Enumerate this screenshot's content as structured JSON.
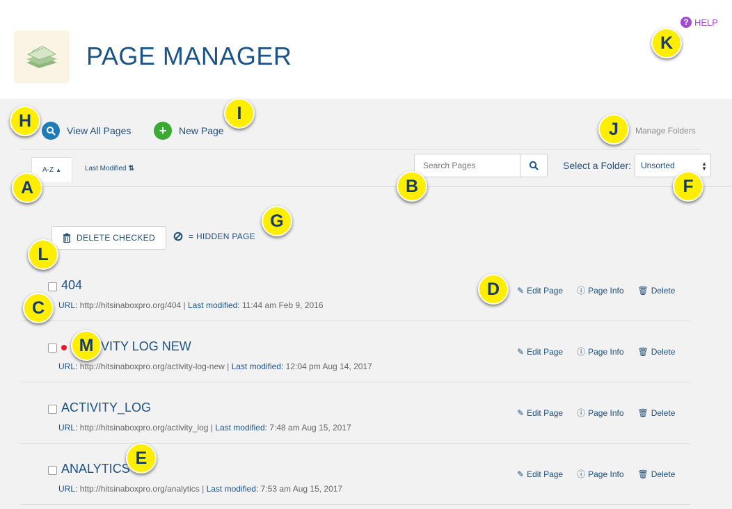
{
  "header": {
    "title": "PAGE MANAGER",
    "help_label": "HELP"
  },
  "nav": {
    "view_all": "View All Pages",
    "new_page": "New Page",
    "manage_folders": "Manage Folders"
  },
  "sort": {
    "az": "A-Z",
    "last_modified": "Last Modified"
  },
  "search": {
    "placeholder": "Search Pages"
  },
  "folder": {
    "label": "Select a Folder:",
    "selected": "Unsorted"
  },
  "toolbar": {
    "delete_checked": "DELETE CHECKED",
    "hidden_legend": "= HIDDEN PAGE"
  },
  "actions": {
    "edit": "Edit Page",
    "info": "Page Info",
    "delete": "Delete"
  },
  "meta_labels": {
    "url": "URL:",
    "modified": "Last modified:",
    "sep": "|"
  },
  "pages": [
    {
      "name": "404",
      "url": "http://hitsinaboxpro.org/404",
      "modified": "11:44 am Feb 9, 2016",
      "hidden": false
    },
    {
      "name": "VITY LOG NEW",
      "url": "http://hitsinaboxpro.org/activity-log-new",
      "modified": "12:04 pm Aug 14, 2017",
      "hidden": true
    },
    {
      "name": "ACTIVITY_LOG",
      "url": "http://hitsinaboxpro.org/activity_log",
      "modified": "7:48 am Aug 15, 2017",
      "hidden": false
    },
    {
      "name": "ANALYTICS",
      "url": "http://hitsinaboxpro.org/analytics",
      "modified": "7:53 am Aug 15, 2017",
      "hidden": false
    }
  ],
  "markers": [
    "A",
    "B",
    "C",
    "D",
    "E",
    "F",
    "G",
    "H",
    "I",
    "J",
    "K",
    "L",
    "M"
  ],
  "colors": {
    "brand": "#1a5387",
    "help": "#a34ad0",
    "view_all_icon": "#1f7bb5",
    "new_page_icon": "#3aaa35",
    "hidden_dot": "#e21c2c",
    "marker": "#ffee00"
  }
}
